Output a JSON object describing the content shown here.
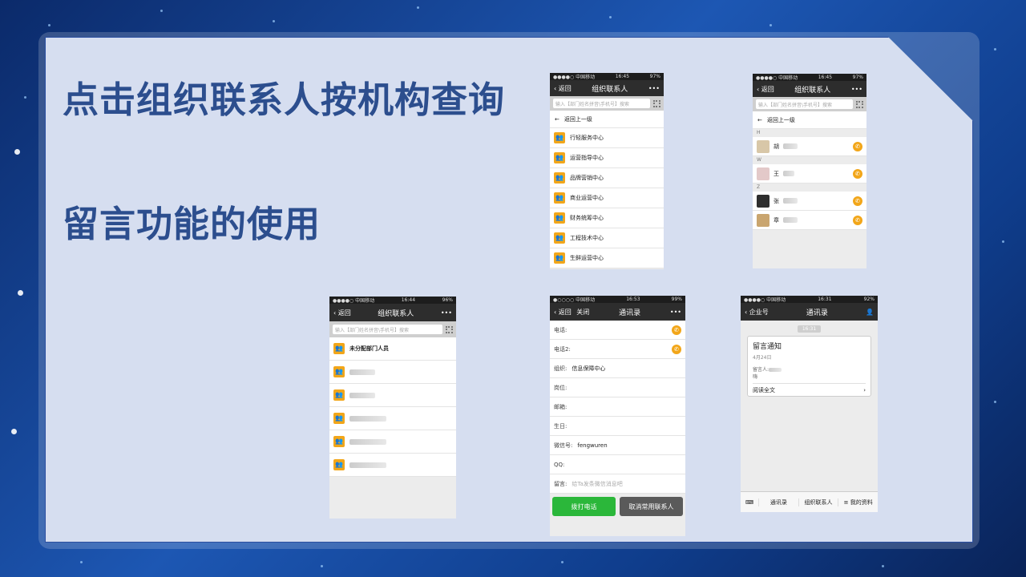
{
  "slide": {
    "heading1": "点击组织联系人按机构查询",
    "heading2": "留言功能的使用"
  },
  "phone1": {
    "status_left": "●●●●○ 中国移动",
    "status_time": "16:45",
    "status_right": "97%",
    "back": "返回",
    "title": "组织联系人",
    "more": "•••",
    "search_placeholder": "输入【部门姓名拼音\\手机号】搜索",
    "back_level": "返回上一级",
    "items": [
      "行轻服务中心",
      "运营指导中心",
      "品牌营销中心",
      "商业运营中心",
      "财务统筹中心",
      "工程技术中心",
      "生鲜运营中心"
    ]
  },
  "phone2": {
    "status_left": "●●●●○ 中国移动",
    "status_time": "16:45",
    "status_right": "97%",
    "back": "返回",
    "title": "组织联系人",
    "more": "•••",
    "search_placeholder": "输入【部门姓名拼音\\手机号】搜索",
    "back_level": "返回上一级",
    "sections": [
      {
        "letter": "H",
        "names": [
          "胡"
        ]
      },
      {
        "letter": "W",
        "names": [
          "王"
        ]
      },
      {
        "letter": "Z",
        "names": [
          "张",
          "章"
        ]
      }
    ]
  },
  "phone3": {
    "status_left": "●●●●○ 中国移动",
    "status_time": "16:44",
    "status_right": "96%",
    "back": "返回",
    "title": "组织联系人",
    "more": "•••",
    "search_placeholder": "输入【部门姓名拼音\\手机号】搜索",
    "items": [
      "未分配部门人员",
      "",
      "",
      "",
      "",
      ""
    ]
  },
  "phone4": {
    "status_left": "●○○○○ 中国移动",
    "status_time": "16:53",
    "status_right": "99%",
    "back": "返回",
    "close": "关闭",
    "title": "通讯录",
    "more": "•••",
    "fields": [
      {
        "label": "电话:",
        "value": ""
      },
      {
        "label": "电话2:",
        "value": ""
      },
      {
        "label": "组织:",
        "value": "信息保障中心"
      },
      {
        "label": "岗位:",
        "value": ""
      },
      {
        "label": "邮箱:",
        "value": ""
      },
      {
        "label": "生日:",
        "value": ""
      },
      {
        "label": "微信号:",
        "value": "fengwuren"
      },
      {
        "label": "QQ:",
        "value": ""
      },
      {
        "label": "留言:",
        "value": "给Ta发条微信消息吧"
      }
    ],
    "call_button": "拨打电话",
    "cancel_button": "取消常用联系人"
  },
  "phone5": {
    "status_left": "●●●●○ 中国移动",
    "status_time": "16:31",
    "status_right": "92%",
    "back": "企业号",
    "title": "通讯录",
    "time_stamp": "16:31",
    "card_title": "留言通知",
    "card_date": "4月24日",
    "card_sender": "留言人:",
    "card_msg": "嗨",
    "card_link": "阅读全文",
    "tabs": [
      "通讯录",
      "组织联系人",
      "我的资料"
    ]
  },
  "colors": {
    "heading": "#2c4e8e",
    "accent_orange": "#f2a619",
    "call_green": "#2bb73a",
    "cancel_gray": "#5a5a5a",
    "navbar": "#2d2d2d"
  }
}
